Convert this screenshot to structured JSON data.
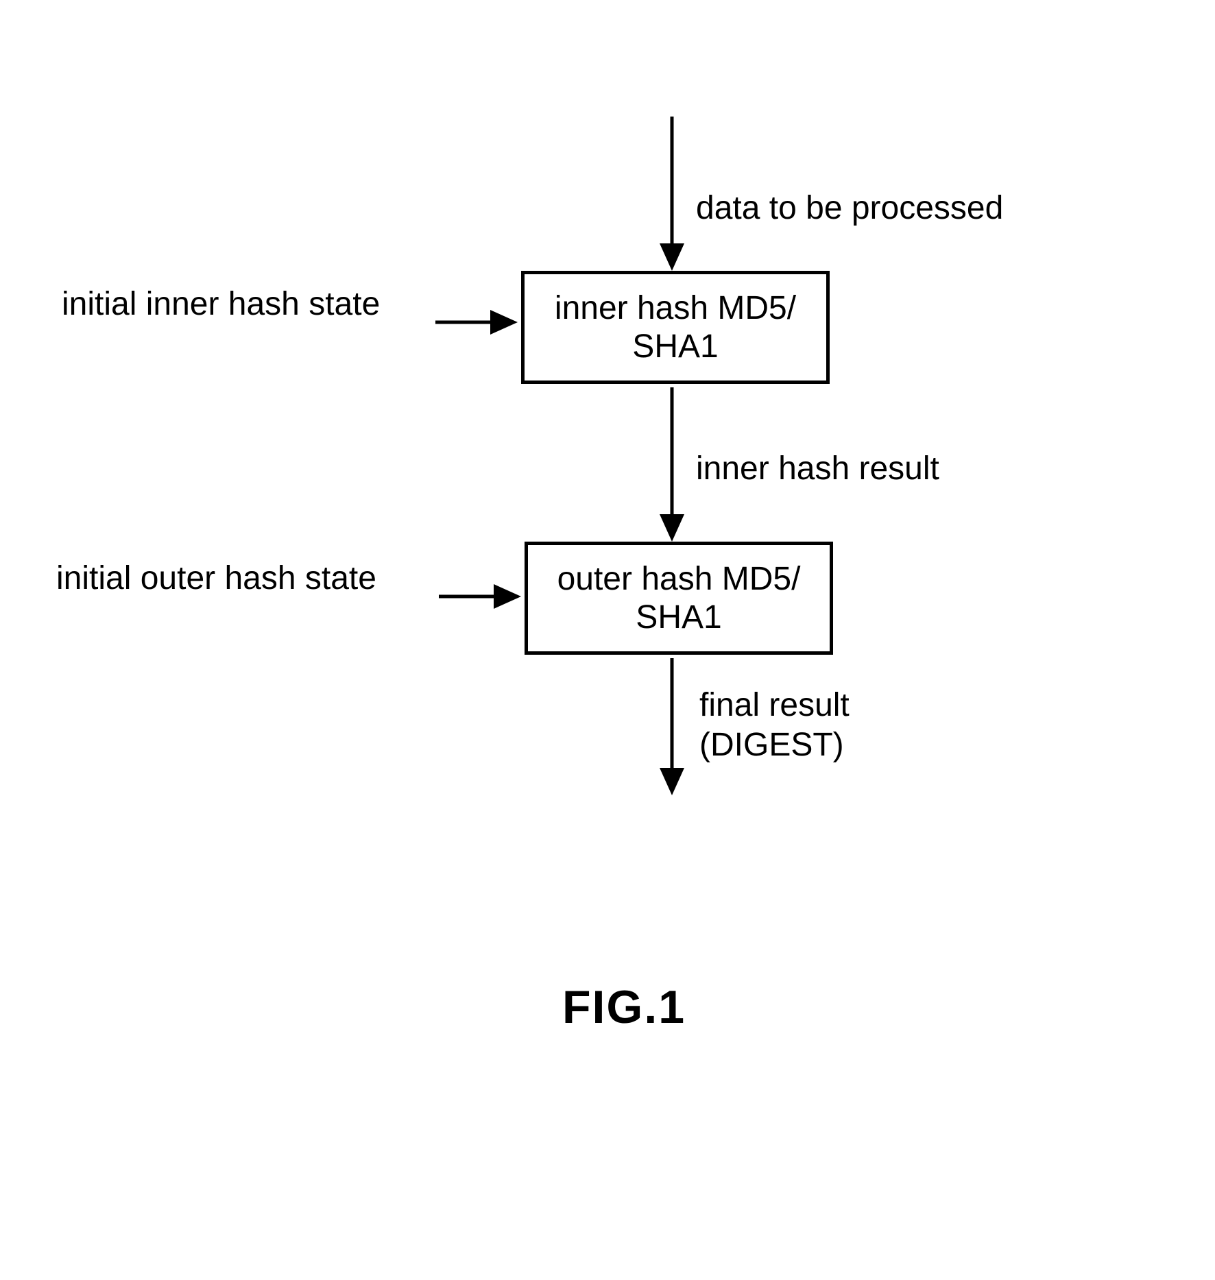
{
  "diagram": {
    "inputTop": "data to be processed",
    "leftInner": "initial inner hash state",
    "boxInner": "inner hash MD5/\nSHA1",
    "midArrow": "inner hash result",
    "leftOuter": "initial outer hash state",
    "boxOuter": "outer hash MD5/\nSHA1",
    "outputBottom": "final result\n(DIGEST)",
    "figLabel": "FIG.1"
  }
}
